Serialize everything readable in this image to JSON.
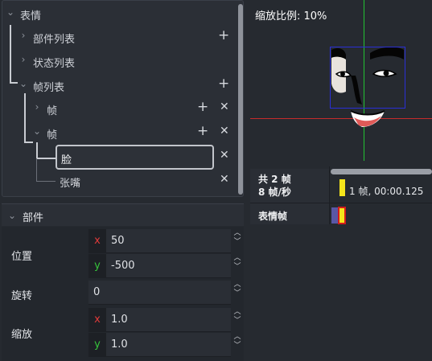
{
  "tree": {
    "root": {
      "label": "表情"
    },
    "components": {
      "label": "部件列表"
    },
    "states": {
      "label": "状态列表"
    },
    "frames": {
      "label": "帧列表"
    },
    "frame_a": {
      "label": "帧"
    },
    "frame_b": {
      "label": "帧"
    },
    "face": {
      "label": "脸"
    },
    "mouth": {
      "label": "张嘴"
    },
    "add_symbol": "+",
    "delete_symbol": "✕"
  },
  "properties": {
    "header": "部件",
    "position": {
      "label": "位置",
      "x_axis": "x",
      "x_value": "50",
      "y_axis": "y",
      "y_value": "-500"
    },
    "rotation": {
      "label": "旋转",
      "value": "0"
    },
    "scale": {
      "label": "缩放",
      "x_axis": "x",
      "x_value": "1.0",
      "y_axis": "y",
      "y_value": "1.0"
    },
    "spin_up": "︿",
    "spin_down": "﹀"
  },
  "preview": {
    "zoom_text": "缩放比例: 10%"
  },
  "timeline": {
    "total_frames": "共 2 帧",
    "fps": "8 帧/秒",
    "current_frame": "1 帧, 00:00.125",
    "track_label": "表情帧"
  },
  "colors": {
    "x_axis": "#e03a3a",
    "y_axis": "#36c43b",
    "timeline_cursor": "#f5e51b",
    "keyframe_border": "#d21b1b",
    "bbox": "#2a2fd6"
  }
}
